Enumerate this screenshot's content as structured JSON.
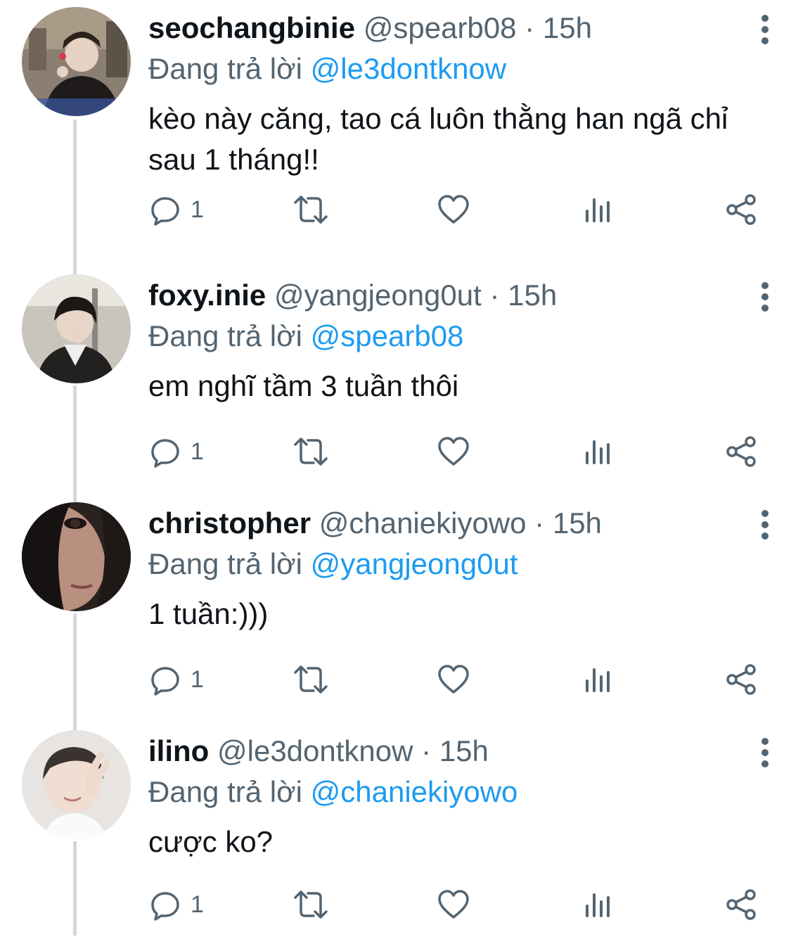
{
  "tweets": [
    {
      "name": "seochangbinie",
      "handle": "@spearb08",
      "separator": "·",
      "time": "15h",
      "reply_prefix": "Đang trả lời",
      "reply_to": "@le3dontknow",
      "text": "kèo này căng, tao cá luôn thằng han ngã chỉ sau 1 tháng!!",
      "reply_count": "1"
    },
    {
      "name": "foxy.inie",
      "handle": "@yangjeong0ut",
      "separator": "·",
      "time": "15h",
      "reply_prefix": "Đang trả lời",
      "reply_to": "@spearb08",
      "text": "em nghĩ tầm 3 tuần thôi",
      "reply_count": "1"
    },
    {
      "name": "christopher",
      "handle": "@chaniekiyowo",
      "separator": "·",
      "time": "15h",
      "reply_prefix": "Đang trả lời",
      "reply_to": "@yangjeong0ut",
      "text": "1 tuần:)))",
      "reply_count": "1"
    },
    {
      "name": "ilino",
      "handle": "@le3dontknow",
      "separator": "·",
      "time": "15h",
      "reply_prefix": "Đang trả lời",
      "reply_to": "@chaniekiyowo",
      "text": "cược ko?",
      "reply_count": "1"
    }
  ],
  "icons": {
    "reply": "reply-icon",
    "retweet": "retweet-icon",
    "like": "heart-icon",
    "views": "views-icon",
    "share": "share-icon",
    "more": "more-vertical-icon"
  },
  "colors": {
    "text": "#0f1419",
    "secondary": "#536471",
    "link": "#1d9bf0",
    "thread_line": "#cfd9de"
  }
}
